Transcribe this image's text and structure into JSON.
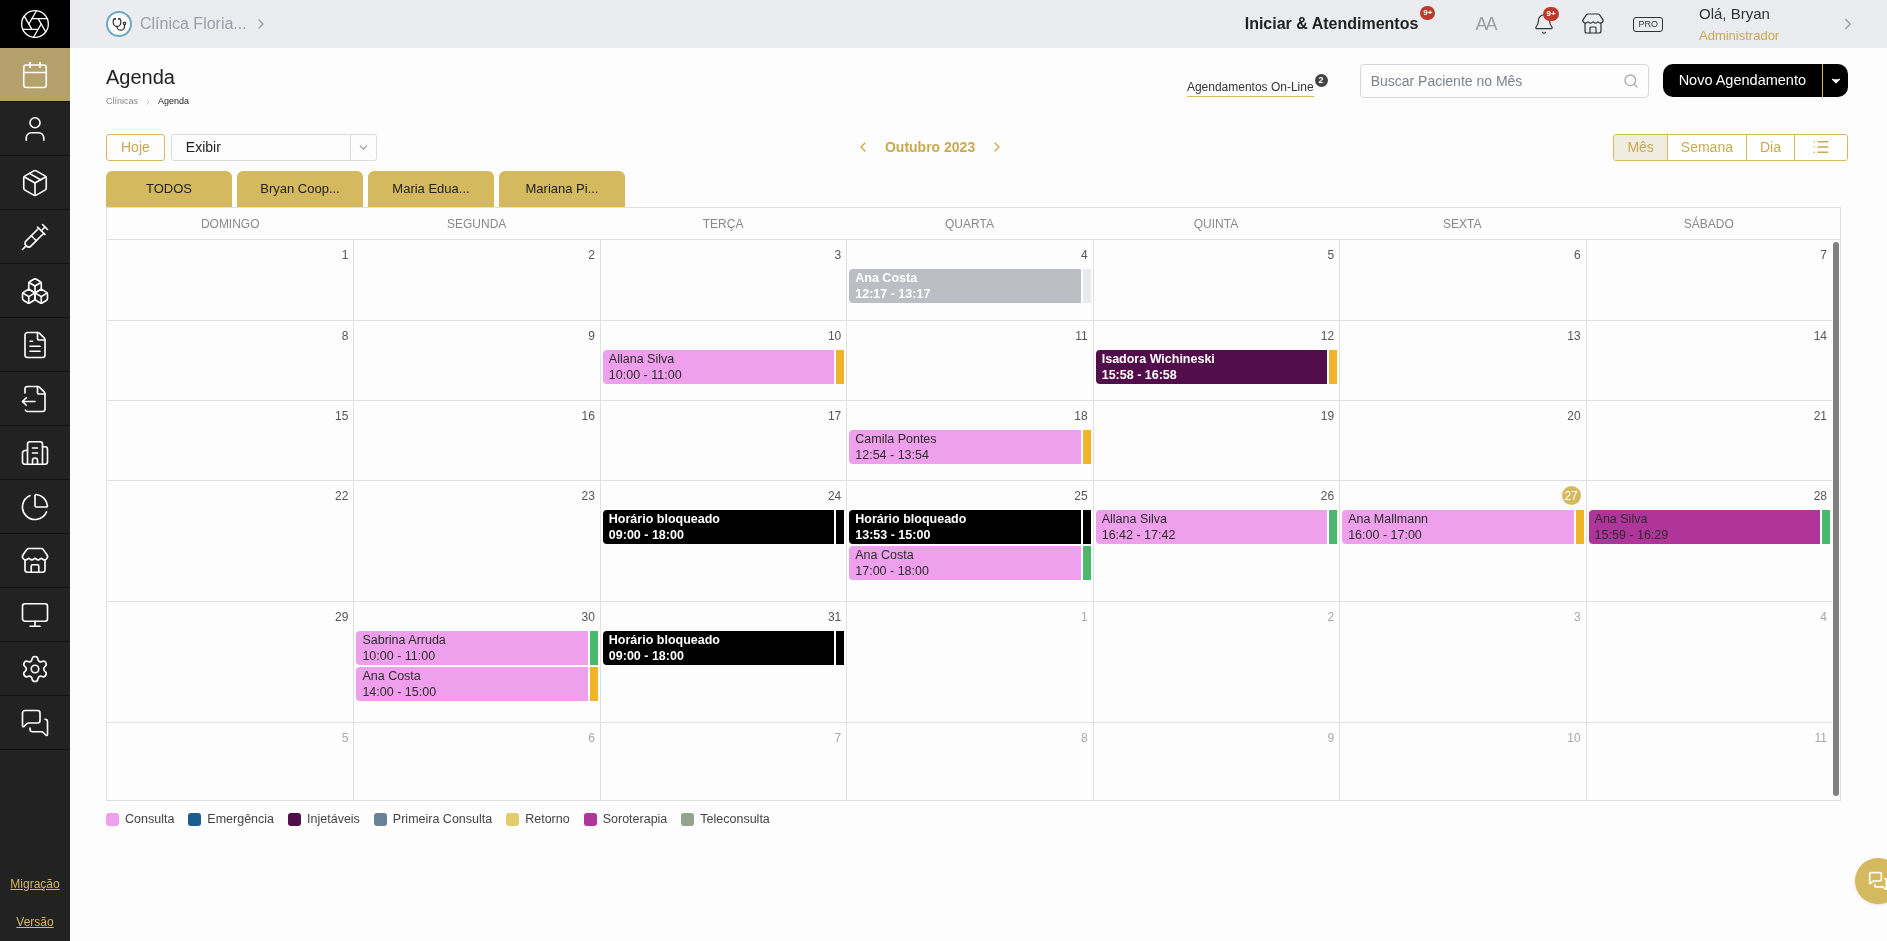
{
  "sidebar": {
    "items": [
      {
        "selected": true
      },
      {
        "selected": false
      },
      {
        "selected": false
      },
      {
        "selected": false
      },
      {
        "selected": false
      },
      {
        "selected": false
      },
      {
        "selected": false
      },
      {
        "selected": false
      },
      {
        "selected": false
      },
      {
        "selected": false
      },
      {
        "selected": false
      },
      {
        "selected": false
      },
      {
        "selected": false
      }
    ],
    "links": [
      "Migração",
      "Versão"
    ]
  },
  "topbar": {
    "clinic": "Clínica Floria...",
    "start_button": "Iniciar & Atendimentos",
    "start_badge": "9+",
    "font_toggle": "AA",
    "notifications_badge": "9+",
    "plan_badge": "PRO",
    "greeting": "Olá, Bryan",
    "role": "Administrador"
  },
  "header": {
    "title": "Agenda",
    "breadcrumb": [
      "Clínicas",
      "Agenda"
    ],
    "online_link": "Agendamentos On-Line",
    "online_badge": "2",
    "search": {
      "placeholder": "Buscar Paciente no Mês"
    },
    "new_button": "Novo Agendamento"
  },
  "toolbar": {
    "today_button": "Hoje",
    "display_select": "Exibir",
    "month": "Outubro 2023",
    "views": [
      {
        "label": "Mês",
        "selected": true
      },
      {
        "label": "Semana",
        "selected": false
      },
      {
        "label": "Dia",
        "selected": false
      },
      {
        "kind": "list",
        "selected": false
      }
    ]
  },
  "professional_tabs": [
    "TODOS",
    "Bryan Coop...",
    "Maria Edua...",
    "Mariana Pi..."
  ],
  "calendar": {
    "weekdays": [
      "DOMINGO",
      "SEGUNDA",
      "TERÇA",
      "QUARTA",
      "QUINTA",
      "SEXTA",
      "SÁBADO"
    ],
    "weeks": [
      {
        "days": [
          {
            "number": "1",
            "outside": false,
            "today": false
          },
          {
            "number": "2",
            "outside": false,
            "today": false
          },
          {
            "number": "3",
            "outside": false,
            "today": false
          },
          {
            "number": "4",
            "outside": false,
            "today": false,
            "events": [
              {
                "kind": "inverse",
                "title": "Ana Costa",
                "time": "12:17 - 13:17",
                "color": "#bcbec4",
                "marker": {
                  "color": "#e8e9ec"
                }
              }
            ]
          },
          {
            "number": "5",
            "outside": false,
            "today": false
          },
          {
            "number": "6",
            "outside": false,
            "today": false
          },
          {
            "number": "7",
            "outside": false,
            "today": false
          }
        ]
      },
      {
        "days": [
          {
            "number": "8",
            "outside": false,
            "today": false
          },
          {
            "number": "9",
            "outside": false,
            "today": false
          },
          {
            "number": "10",
            "outside": false,
            "today": false,
            "events": [
              {
                "kind": "appointment",
                "title": "Allana Silva",
                "time": "10:00 - 11:00",
                "color": "#efa0ec",
                "marker": {
                  "color": "#f0b429"
                }
              }
            ]
          },
          {
            "number": "11",
            "outside": false,
            "today": false
          },
          {
            "number": "12",
            "outside": false,
            "today": false,
            "events": [
              {
                "kind": "inverse",
                "title": "Isadora Wichineski",
                "time": "15:58 - 16:58",
                "color": "#520e4b",
                "marker": {
                  "color": "#f0b429"
                }
              }
            ]
          },
          {
            "number": "13",
            "outside": false,
            "today": false
          },
          {
            "number": "14",
            "outside": false,
            "today": false
          }
        ]
      },
      {
        "days": [
          {
            "number": "15",
            "outside": false,
            "today": false
          },
          {
            "number": "16",
            "outside": false,
            "today": false
          },
          {
            "number": "17",
            "outside": false,
            "today": false
          },
          {
            "number": "18",
            "outside": false,
            "today": false,
            "events": [
              {
                "kind": "appointment",
                "title": "Camila Pontes",
                "time": "12:54 - 13:54",
                "color": "#efa0ec",
                "marker": {
                  "color": "#f0b429"
                }
              }
            ]
          },
          {
            "number": "19",
            "outside": false,
            "today": false
          },
          {
            "number": "20",
            "outside": false,
            "today": false
          },
          {
            "number": "21",
            "outside": false,
            "today": false
          }
        ]
      },
      {
        "days": [
          {
            "number": "22",
            "outside": false,
            "today": false
          },
          {
            "number": "23",
            "outside": false,
            "today": false
          },
          {
            "number": "24",
            "outside": false,
            "today": false,
            "events": [
              {
                "kind": "blocked",
                "title": "Horário bloqueado",
                "time": "09:00 - 18:00",
                "color": "#000000",
                "marker": {
                  "color": "#000000"
                }
              }
            ]
          },
          {
            "number": "25",
            "outside": false,
            "today": false,
            "events": [
              {
                "kind": "blocked",
                "title": "Horário bloqueado",
                "time": "13:53 - 15:00",
                "color": "#000000",
                "marker": {
                  "color": "#000000"
                }
              },
              {
                "kind": "appointment",
                "title": "Ana Costa",
                "time": "17:00 - 18:00",
                "color": "#efa0ec",
                "marker": {
                  "color": "#4cb86b"
                }
              }
            ]
          },
          {
            "number": "26",
            "outside": false,
            "today": false,
            "events": [
              {
                "kind": "appointment",
                "title": "Allana Silva",
                "time": "16:42 - 17:42",
                "color": "#efa0ec",
                "marker": {
                  "color": "#4cb86b"
                }
              }
            ]
          },
          {
            "number": "27",
            "outside": false,
            "today": true,
            "events": [
              {
                "kind": "appointment",
                "title": "Ana Mallmann",
                "time": "16:00 - 17:00",
                "color": "#efa0ec",
                "marker": {
                  "color": "#f0b429"
                }
              }
            ]
          },
          {
            "number": "28",
            "outside": false,
            "today": false,
            "events": [
              {
                "kind": "appointment",
                "title": "Ana Silva",
                "time": "15:59 - 16:29",
                "color": "#b0359a",
                "marker": {
                  "color": "#4cb86b"
                }
              }
            ]
          }
        ]
      },
      {
        "days": [
          {
            "number": "29",
            "outside": false,
            "today": false
          },
          {
            "number": "30",
            "outside": false,
            "today": false,
            "events": [
              {
                "kind": "appointment",
                "title": "Sabrina Arruda",
                "time": "10:00 - 11:00",
                "color": "#efa0ec",
                "marker": {
                  "color": "#4cb86b"
                }
              },
              {
                "kind": "appointment",
                "title": "Ana Costa",
                "time": "14:00 - 15:00",
                "color": "#efa0ec",
                "marker": {
                  "color": "#f0b429"
                }
              }
            ]
          },
          {
            "number": "31",
            "outside": false,
            "today": false,
            "events": [
              {
                "kind": "blocked",
                "title": "Horário bloqueado",
                "time": "09:00 - 18:00",
                "color": "#000000",
                "marker": {
                  "color": "#000000"
                }
              }
            ]
          },
          {
            "number": "1",
            "outside": true,
            "today": false
          },
          {
            "number": "2",
            "outside": true,
            "today": false
          },
          {
            "number": "3",
            "outside": true,
            "today": false
          },
          {
            "number": "4",
            "outside": true,
            "today": false
          }
        ]
      },
      {
        "days": [
          {
            "number": "5",
            "outside": true,
            "today": false
          },
          {
            "number": "6",
            "outside": true,
            "today": false
          },
          {
            "number": "7",
            "outside": true,
            "today": false
          },
          {
            "number": "8",
            "outside": true,
            "today": false
          },
          {
            "number": "9",
            "outside": true,
            "today": false
          },
          {
            "number": "10",
            "outside": true,
            "today": false
          },
          {
            "number": "11",
            "outside": true,
            "today": false
          }
        ]
      }
    ]
  },
  "legend": [
    {
      "label": "Consulta",
      "color": "#efa0ec"
    },
    {
      "label": "Emergência",
      "color": "#1b5e8e"
    },
    {
      "label": "Injetáveis",
      "color": "#520e4b"
    },
    {
      "label": "Primeira Consulta",
      "color": "#68829a"
    },
    {
      "label": "Retorno",
      "color": "#e3cd6a"
    },
    {
      "label": "Soroterapia",
      "color": "#b0359a"
    },
    {
      "label": "Teleconsulta",
      "color": "#94a38f"
    }
  ]
}
